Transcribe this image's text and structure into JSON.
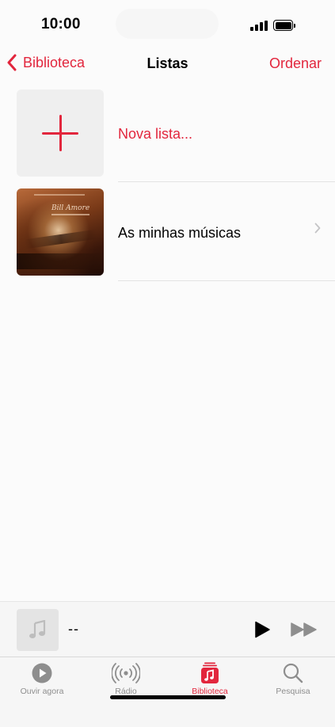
{
  "status_bar": {
    "time": "10:00"
  },
  "nav": {
    "back_label": "Biblioteca",
    "title": "Listas",
    "sort_label": "Ordenar"
  },
  "rows": [
    {
      "label": "Nova lista...",
      "icon": "plus-icon",
      "color": "#e2263d"
    },
    {
      "label": "As minhas músicas",
      "icon": "chevron-right-icon",
      "cover_title": "Bill Amore"
    }
  ],
  "mini_player": {
    "title": "--"
  },
  "tabs": [
    {
      "label": "Ouvir agora",
      "icon": "play-circle-icon",
      "active": false
    },
    {
      "label": "Rádio",
      "icon": "radio-waves-icon",
      "active": false
    },
    {
      "label": "Biblioteca",
      "icon": "music-library-icon",
      "active": true
    },
    {
      "label": "Pesquisa",
      "icon": "search-icon",
      "active": false
    }
  ],
  "colors": {
    "accent": "#e2263d",
    "inactive": "#8e8e8e"
  }
}
